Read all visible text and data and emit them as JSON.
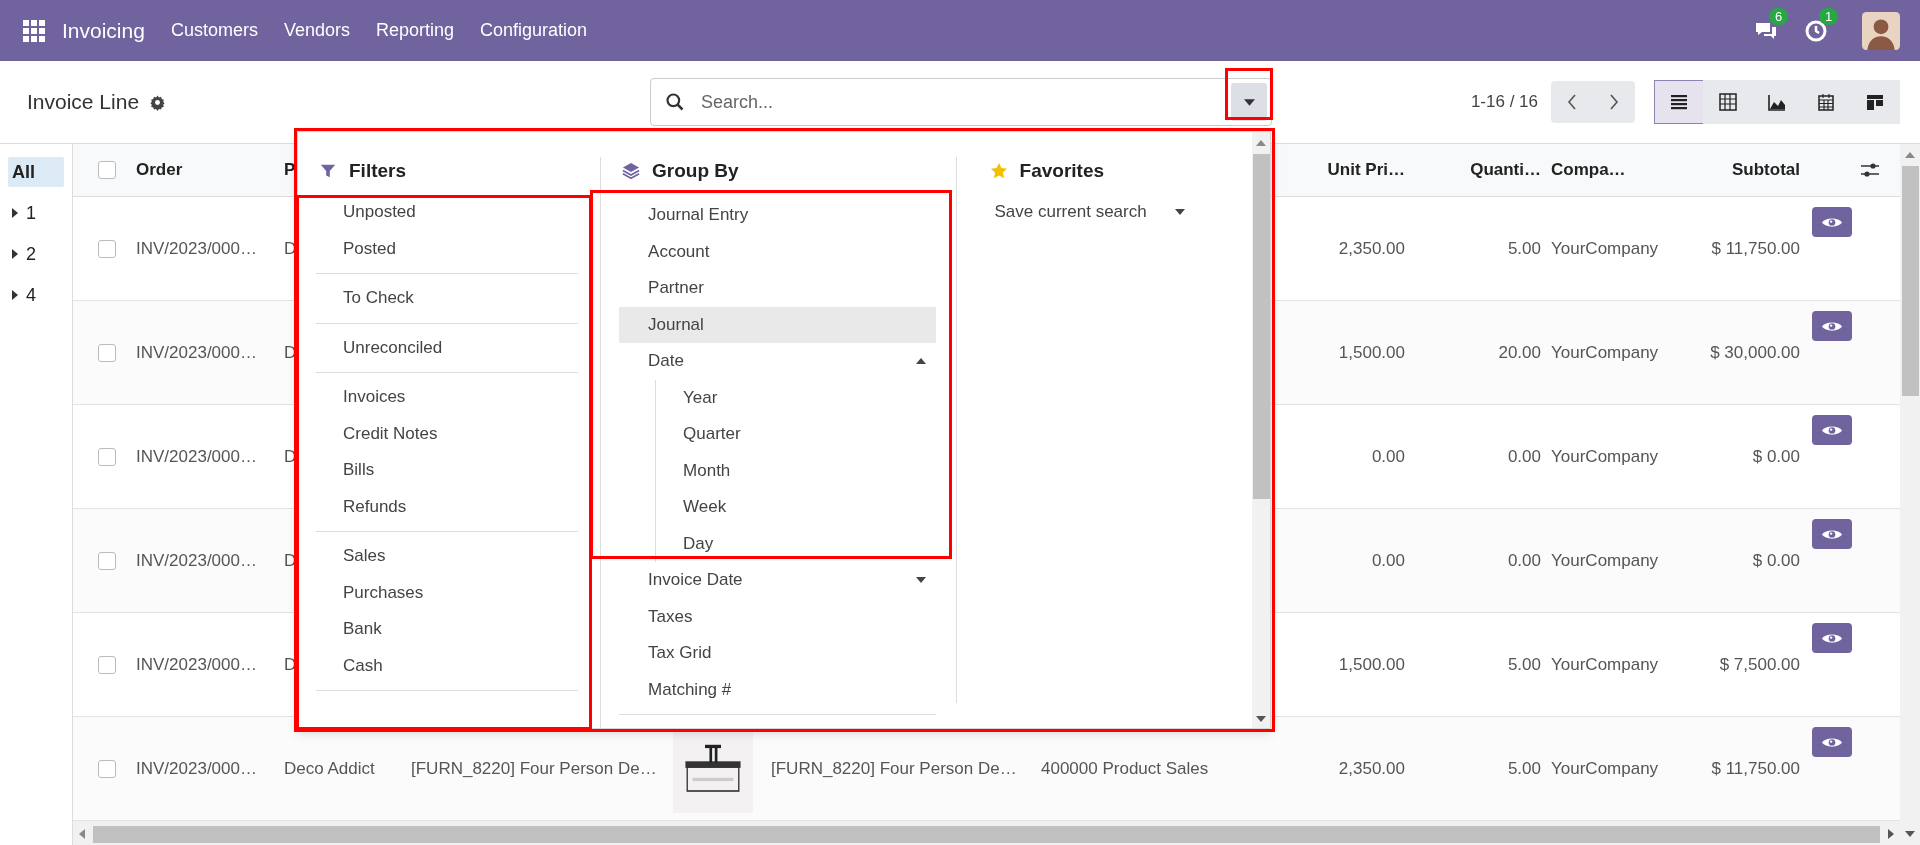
{
  "navbar": {
    "app": "Invoicing",
    "menu": [
      "Customers",
      "Vendors",
      "Reporting",
      "Configuration"
    ],
    "messages_badge": "6",
    "activities_badge": "1"
  },
  "control_panel": {
    "title": "Invoice Line",
    "search": {
      "placeholder": "Search..."
    },
    "pager": "1-16 / 16",
    "views": [
      {
        "kind": "list",
        "selected": true
      },
      {
        "kind": "pivot",
        "selected": false
      },
      {
        "kind": "graph",
        "selected": false
      },
      {
        "kind": "calendar",
        "selected": false
      },
      {
        "kind": "kanban",
        "selected": false
      }
    ]
  },
  "sidebar": [
    {
      "label": "All",
      "selected": true,
      "expandable": false
    },
    {
      "label": "1",
      "selected": false,
      "expandable": true
    },
    {
      "label": "2",
      "selected": false,
      "expandable": true
    },
    {
      "label": "4",
      "selected": false,
      "expandable": true
    }
  ],
  "table": {
    "select_all_checked": false,
    "header": {
      "order": "Order",
      "partner": "P",
      "unit_price": "Unit Pri…",
      "quantity": "Quanti…",
      "company": "Compa…",
      "subtotal": "Subtotal"
    },
    "rows": [
      {
        "checked": false,
        "order": "INV/2023/000…",
        "partner": "D",
        "unit_price": "2,350.00",
        "quantity": "5.00",
        "company": "YourCompany",
        "subtotal": "$ 11,750.00"
      },
      {
        "checked": false,
        "order": "INV/2023/000…",
        "partner": "D",
        "unit_price": "1,500.00",
        "quantity": "20.00",
        "company": "YourCompany",
        "subtotal": "$ 30,000.00"
      },
      {
        "checked": false,
        "order": "INV/2023/000…",
        "partner": "D",
        "unit_price": "0.00",
        "quantity": "0.00",
        "company": "YourCompany",
        "subtotal": "$ 0.00"
      },
      {
        "checked": false,
        "order": "INV/2023/000…",
        "partner": "D",
        "unit_price": "0.00",
        "quantity": "0.00",
        "company": "YourCompany",
        "subtotal": "$ 0.00"
      },
      {
        "checked": false,
        "order": "INV/2023/000…",
        "partner": "D",
        "unit_price": "1,500.00",
        "quantity": "5.00",
        "company": "YourCompany",
        "subtotal": "$ 7,500.00"
      },
      {
        "checked": false,
        "order": "INV/2023/000…",
        "partner": "Deco Addict",
        "label": "[FURN_8220] Four Person De…",
        "label2": "[FURN_8220] Four Person De…",
        "account": "400000 Product Sales",
        "unit_price": "2,350.00",
        "quantity": "5.00",
        "company": "YourCompany",
        "subtotal": "$ 11,750.00"
      }
    ]
  },
  "search_panel": {
    "filters": {
      "title": "Filters",
      "groups": [
        [
          "Unposted",
          "Posted"
        ],
        [
          "To Check"
        ],
        [
          "Unreconciled"
        ],
        [
          "Invoices",
          "Credit Notes",
          "Bills",
          "Refunds"
        ],
        [
          "Sales",
          "Purchases",
          "Bank",
          "Cash"
        ]
      ]
    },
    "group_by": {
      "title": "Group By",
      "items": [
        {
          "label": "Journal Entry",
          "highlighted": false
        },
        {
          "label": "Account",
          "highlighted": false
        },
        {
          "label": "Partner",
          "highlighted": false
        },
        {
          "label": "Journal",
          "highlighted": true
        },
        {
          "label": "Date",
          "highlighted": false,
          "expanded": true,
          "children": [
            "Year",
            "Quarter",
            "Month",
            "Week",
            "Day"
          ]
        },
        {
          "label": "Invoice Date",
          "highlighted": false,
          "expanded": false
        },
        {
          "label": "Taxes",
          "highlighted": false
        },
        {
          "label": "Tax Grid",
          "highlighted": false
        },
        {
          "label": "Matching #",
          "highlighted": false
        }
      ]
    },
    "favorites": {
      "title": "Favorites",
      "items": [
        {
          "label": "Save current search",
          "expanded": false
        }
      ]
    }
  }
}
